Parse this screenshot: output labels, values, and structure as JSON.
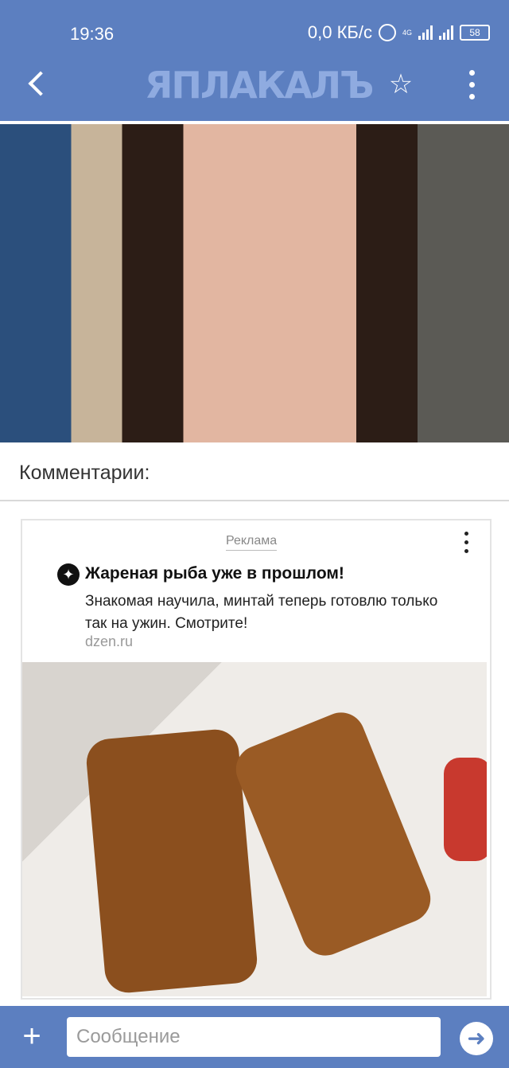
{
  "status": {
    "time": "19:36",
    "network_speed": "0,0 КБ/с",
    "network_type": "4G",
    "battery": "58"
  },
  "header": {
    "logo_text": "ЯПЛАКАЛЪ",
    "icons": {
      "back": "back-arrow-icon",
      "favorite": "star-icon",
      "more": "more-vertical-icon"
    }
  },
  "post": {
    "photo": "woman-selfie-photo"
  },
  "comments": {
    "title": "Комментарии:"
  },
  "ad": {
    "label": "Реклама",
    "title": "Жареная рыба уже в прошлом!",
    "text": "Знакомая научила, минтай теперь готовлю только так на ужин. Смотрите!",
    "domain": "dzen.ru",
    "image": "fried-fish-photo"
  },
  "composer": {
    "placeholder": "Сообщение",
    "icons": {
      "add": "plus-icon",
      "send": "send-arrow-icon"
    }
  },
  "colors": {
    "brand": "#5c7fc0",
    "logo": "#8fabe0"
  }
}
